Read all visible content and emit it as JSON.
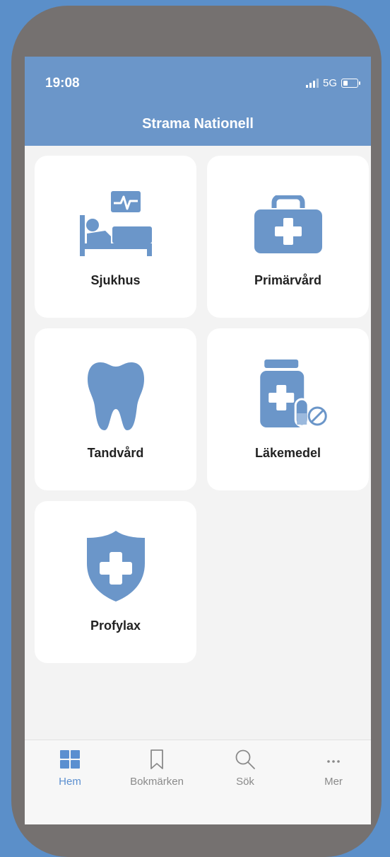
{
  "status": {
    "time": "19:08",
    "network": "5G"
  },
  "app": {
    "title": "Strama Nationell"
  },
  "tiles": [
    {
      "label": "Sjukhus",
      "icon": "hospital-bed-icon"
    },
    {
      "label": "Primärvård",
      "icon": "medical-bag-icon"
    },
    {
      "label": "Tandvård",
      "icon": "tooth-icon"
    },
    {
      "label": "Läkemedel",
      "icon": "medicine-bottle-icon"
    },
    {
      "label": "Profylax",
      "icon": "shield-cross-icon"
    }
  ],
  "tabs": [
    {
      "label": "Hem",
      "icon": "grid-icon",
      "active": true
    },
    {
      "label": "Bokmärken",
      "icon": "bookmark-icon",
      "active": false
    },
    {
      "label": "Sök",
      "icon": "search-icon",
      "active": false
    },
    {
      "label": "Mer",
      "icon": "more-icon",
      "active": false
    }
  ],
  "colors": {
    "accent": "#5b8fd0",
    "header": "#6b96c9",
    "icon": "#6b96c9",
    "background": "#5b8fc9"
  }
}
